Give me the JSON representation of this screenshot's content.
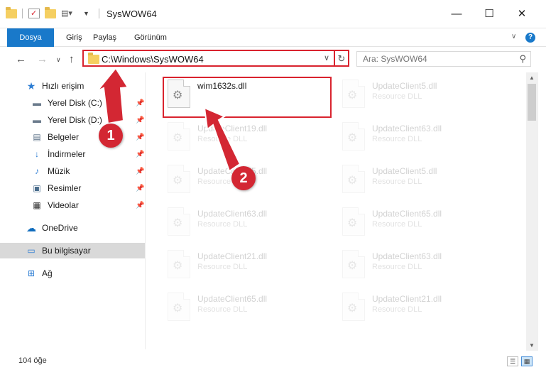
{
  "window": {
    "title": "SysWOW64",
    "minimize": "—",
    "maximize": "☐",
    "close": "✕"
  },
  "ribbon": {
    "tabs": [
      "Dosya",
      "Giriş",
      "Paylaş",
      "Görünüm"
    ],
    "help": "?"
  },
  "address": {
    "path": "C:\\Windows\\SysWOW64",
    "search_placeholder": "Ara: SysWOW64"
  },
  "sidebar": {
    "quick_access": "Hızlı erişim",
    "items": [
      {
        "label": "Yerel Disk (C:)",
        "icon": "drive-icon",
        "pinned": true
      },
      {
        "label": "Yerel Disk (D:)",
        "icon": "drive-icon",
        "pinned": true
      },
      {
        "label": "Belgeler",
        "icon": "documents-icon",
        "pinned": true
      },
      {
        "label": "İndirmeler",
        "icon": "downloads-icon",
        "pinned": true
      },
      {
        "label": "Müzik",
        "icon": "music-icon",
        "pinned": true
      },
      {
        "label": "Resimler",
        "icon": "pictures-icon",
        "pinned": true
      },
      {
        "label": "Videolar",
        "icon": "videos-icon",
        "pinned": true
      }
    ],
    "onedrive": "OneDrive",
    "this_pc": "Bu bilgisayar",
    "network": "Ağ"
  },
  "files": {
    "highlighted": {
      "name": "wim1632s.dll",
      "type": ""
    },
    "left_column": [
      {
        "name": "UpdateClient19.dll",
        "type": "Resource DLL"
      },
      {
        "name": "UpdateClient65.dll",
        "type": "Resource DLL"
      },
      {
        "name": "UpdateClient63.dll",
        "type": "Resource DLL"
      },
      {
        "name": "UpdateClient21.dll",
        "type": "Resource DLL"
      },
      {
        "name": "UpdateClient65.dll",
        "type": "Resource DLL"
      }
    ],
    "right_column": [
      {
        "name": "UpdateClient5.dll",
        "type": "Resource DLL"
      },
      {
        "name": "UpdateClient63.dll",
        "type": "Resource DLL"
      },
      {
        "name": "UpdateClient5.dll",
        "type": "Resource DLL"
      },
      {
        "name": "UpdateClient65.dll",
        "type": "Resource DLL"
      },
      {
        "name": "UpdateClient63.dll",
        "type": "Resource DLL"
      },
      {
        "name": "UpdateClient21.dll",
        "type": "Resource DLL"
      }
    ]
  },
  "status": {
    "item_count": "104 öğe"
  },
  "callouts": [
    "1",
    "2"
  ],
  "colors": {
    "accent": "#1979ca",
    "highlight": "#d9232e",
    "callout": "#d32733"
  }
}
